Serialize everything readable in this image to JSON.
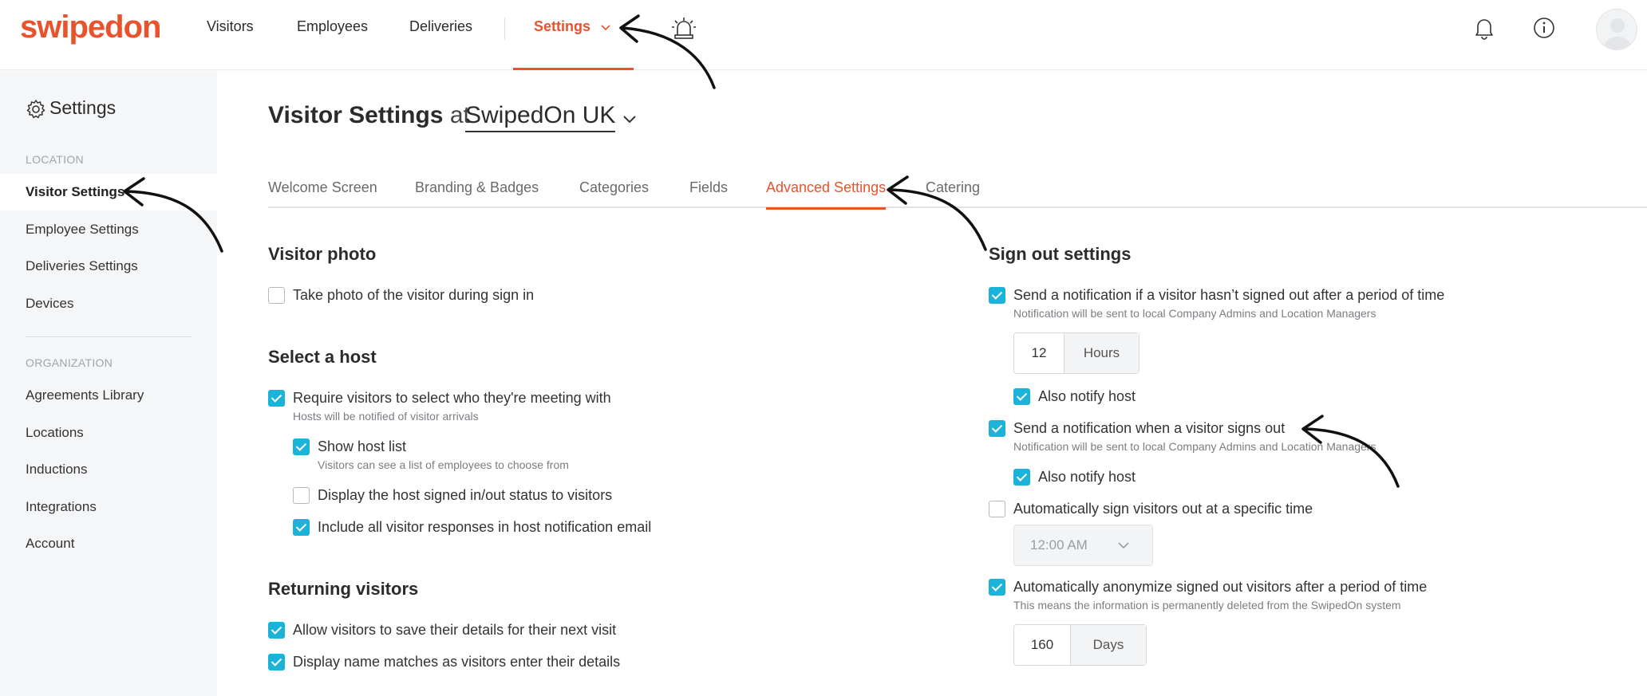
{
  "brand": {
    "logo_text": "swipedon",
    "accent": "#e8522c",
    "check_color": "#1bb3d9"
  },
  "nav": {
    "items": [
      "Visitors",
      "Employees",
      "Deliveries"
    ],
    "settings_label": "Settings",
    "icons": [
      "alarm-icon",
      "bell-icon",
      "info-icon",
      "avatar"
    ]
  },
  "sidebar": {
    "title": "Settings",
    "location_label": "LOCATION",
    "location_items": [
      "Visitor Settings",
      "Employee Settings",
      "Deliveries Settings",
      "Devices"
    ],
    "organization_label": "ORGANIZATION",
    "organization_items": [
      "Agreements Library",
      "Locations",
      "Inductions",
      "Integrations",
      "Account"
    ]
  },
  "header": {
    "title": "Visitor Settings",
    "at": "at",
    "location": "SwipedOn UK"
  },
  "tabs": [
    "Welcome Screen",
    "Branding & Badges",
    "Categories",
    "Fields",
    "Advanced Settings",
    "Catering"
  ],
  "visitor_photo": {
    "title": "Visitor photo",
    "take_photo": "Take photo of the visitor during sign in"
  },
  "select_host": {
    "title": "Select a host",
    "require": "Require visitors to select who they're meeting with",
    "require_hint": "Hosts will be notified of visitor arrivals",
    "show_list": "Show host list",
    "show_list_hint": "Visitors can see a list of employees to choose from",
    "display_status": "Display the host signed in/out status to visitors",
    "include_responses": "Include all visitor responses in host notification email"
  },
  "returning": {
    "title": "Returning visitors",
    "save_details": "Allow visitors to save their details for their next visit",
    "name_matches": "Display name matches as visitors enter their details"
  },
  "sign_out": {
    "title": "Sign out settings",
    "notify_period": "Send a notification if a visitor hasn’t signed out after a period of time",
    "notify_period_hint": "Notification will be sent to local Company Admins and Location Managers",
    "hours_value": "12",
    "hours_unit": "Hours",
    "also_notify_host": "Also notify host",
    "notify_signout": "Send a notification when a visitor signs out",
    "notify_signout_hint": "Notification will be sent to local Company Admins and Location Managers",
    "also_notify_host_2": "Also notify host",
    "auto_signout": "Automatically sign visitors out at a specific time",
    "time_value": "12:00 AM",
    "anonymize": "Automatically anonymize signed out visitors after a period of time",
    "anonymize_hint": "This means the information is permanently deleted from the SwipedOn system",
    "days_value": "160",
    "days_unit": "Days"
  }
}
